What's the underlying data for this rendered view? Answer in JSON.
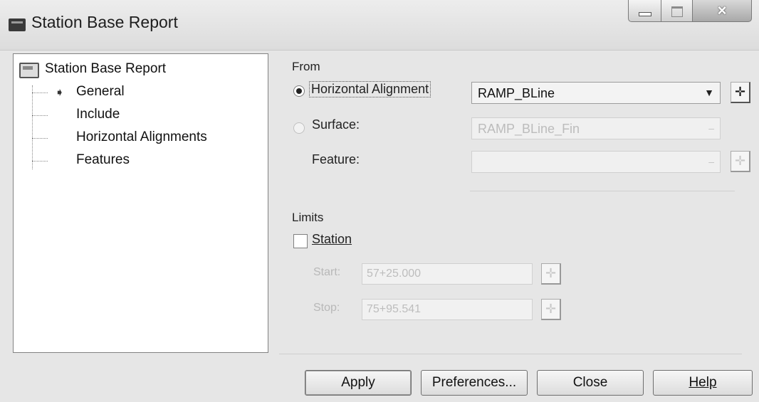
{
  "window": {
    "title": "Station Base Report",
    "controls": {
      "minimize": "minimize-icon",
      "maximize": "maximize-icon",
      "close": "×"
    }
  },
  "tree": {
    "root": "Station Base Report",
    "items": [
      {
        "label": "General",
        "selected": true
      },
      {
        "label": "Include"
      },
      {
        "label": "Horizontal Alignments"
      },
      {
        "label": "Features"
      }
    ],
    "selected_marker": "➧"
  },
  "from": {
    "group_label": "From",
    "horizontal_alignment": {
      "label": "Horizontal Alignment",
      "checked": true,
      "value": "RAMP_BLine"
    },
    "surface": {
      "label": "Surface:",
      "checked": false,
      "value": "RAMP_BLine_Fin"
    },
    "feature": {
      "label": "Feature:",
      "value": ""
    },
    "pick_icon": "✛",
    "drop_icon": "▼"
  },
  "limits": {
    "group_label": "Limits",
    "station": {
      "label": "Station",
      "checked": false
    },
    "start": {
      "label": "Start:",
      "value": "57+25.000"
    },
    "stop": {
      "label": "Stop:",
      "value": "75+95.541"
    }
  },
  "buttons": {
    "apply": "Apply",
    "preferences": "Preferences...",
    "close": "Close",
    "help": "Help"
  }
}
